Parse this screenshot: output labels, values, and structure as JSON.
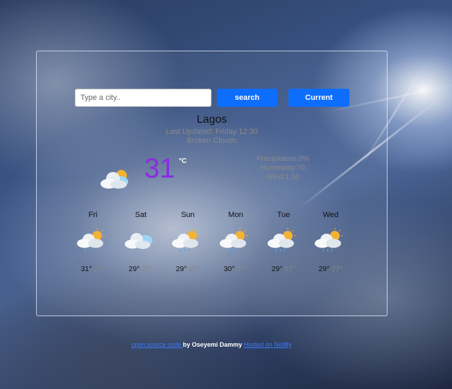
{
  "search": {
    "placeholder": "Type a city..",
    "search_label": "search",
    "current_label": "Current"
  },
  "current": {
    "city": "Lagos",
    "last_updated": "Last Updated: Friday 12:30",
    "description": "Broken Clouds",
    "temperature": "31",
    "unit": "°C",
    "icon": "sun-cloud-icon",
    "precipitation": "Precipitation:0%",
    "humidity": "Hummidity:70",
    "wind": "Wind:1.54"
  },
  "forecast": [
    {
      "day": "Fri",
      "icon": "sun-cloud-rain-icon",
      "high": "31°",
      "low": "27°"
    },
    {
      "day": "Sat",
      "icon": "sun-cloud-icon",
      "high": "29°",
      "low": "27°"
    },
    {
      "day": "Sun",
      "icon": "sun-cloud-rain-icon",
      "high": "29°",
      "low": "27°"
    },
    {
      "day": "Mon",
      "icon": "sun-cloud-rain-icon",
      "high": "30°",
      "low": "27°"
    },
    {
      "day": "Tue",
      "icon": "sun-cloud-rain-icon",
      "high": "29°",
      "low": "27°"
    },
    {
      "day": "Wed",
      "icon": "sun-cloud-rain-icon",
      "high": "29°",
      "low": "27°"
    }
  ],
  "footer": {
    "source_link": "open source code ",
    "author": "by Oseyemi Dammy ",
    "host_link": "Hosted on Netlify"
  },
  "colors": {
    "button": "#0d6efd",
    "temperature": "#8a2be2",
    "link": "#3a7bff"
  }
}
